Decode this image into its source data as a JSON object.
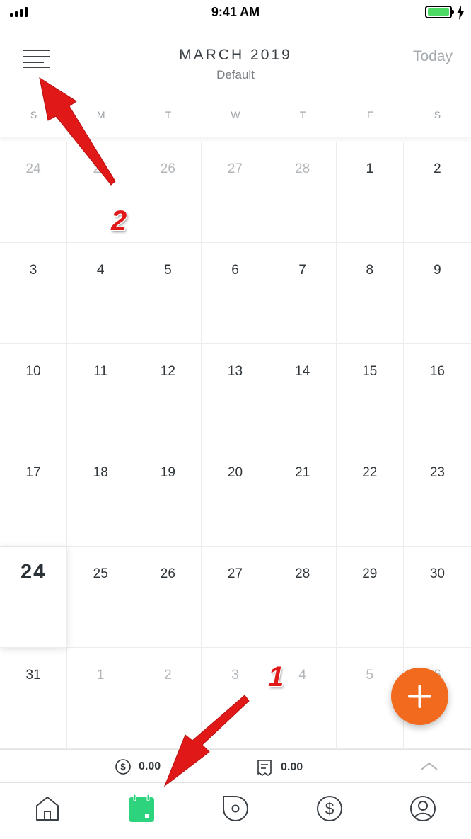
{
  "status_bar": {
    "time": "9:41 AM"
  },
  "header": {
    "month_title": "MARCH 2019",
    "calendar_name": "Default",
    "today_label": "Today",
    "weekdays": [
      "S",
      "M",
      "T",
      "W",
      "T",
      "F",
      "S"
    ]
  },
  "calendar": {
    "today": "24",
    "weeks": [
      [
        {
          "d": "24",
          "other": true
        },
        {
          "d": "25",
          "other": true
        },
        {
          "d": "26",
          "other": true
        },
        {
          "d": "27",
          "other": true
        },
        {
          "d": "28",
          "other": true
        },
        {
          "d": "1"
        },
        {
          "d": "2"
        }
      ],
      [
        {
          "d": "3"
        },
        {
          "d": "4"
        },
        {
          "d": "5"
        },
        {
          "d": "6"
        },
        {
          "d": "7"
        },
        {
          "d": "8"
        },
        {
          "d": "9"
        }
      ],
      [
        {
          "d": "10"
        },
        {
          "d": "11"
        },
        {
          "d": "12"
        },
        {
          "d": "13"
        },
        {
          "d": "14"
        },
        {
          "d": "15"
        },
        {
          "d": "16"
        }
      ],
      [
        {
          "d": "17"
        },
        {
          "d": "18"
        },
        {
          "d": "19"
        },
        {
          "d": "20"
        },
        {
          "d": "21"
        },
        {
          "d": "22"
        },
        {
          "d": "23"
        }
      ],
      [
        {
          "d": "24",
          "today": true
        },
        {
          "d": "25"
        },
        {
          "d": "26"
        },
        {
          "d": "27"
        },
        {
          "d": "28"
        },
        {
          "d": "29"
        },
        {
          "d": "30"
        }
      ],
      [
        {
          "d": "31"
        },
        {
          "d": "1",
          "other": true
        },
        {
          "d": "2",
          "other": true
        },
        {
          "d": "3",
          "other": true
        },
        {
          "d": "4",
          "other": true
        },
        {
          "d": "5",
          "other": true
        },
        {
          "d": "6",
          "other": true
        }
      ]
    ]
  },
  "summary": {
    "expense_total": "0.00",
    "bill_total": "0.00"
  },
  "tabs": [
    {
      "icon": "home-icon"
    },
    {
      "icon": "calendar-icon",
      "active": true
    },
    {
      "icon": "explore-icon"
    },
    {
      "icon": "dollar-icon"
    },
    {
      "icon": "profile-icon"
    }
  ],
  "annotations": {
    "callout_1": "1",
    "callout_2": "2"
  },
  "colors": {
    "accent": "#f26a1e",
    "active_tab": "#2ed37e",
    "arrow": "#e01818"
  }
}
